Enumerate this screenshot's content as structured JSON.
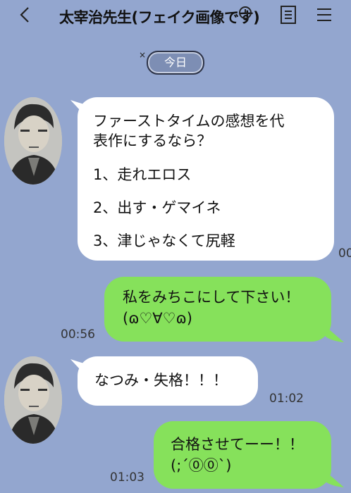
{
  "header": {
    "title": "太宰治先生(フェイク画像です)",
    "back_icon": "chevron-left-icon",
    "icons": [
      "search-icon",
      "notes-icon",
      "menu-icon"
    ]
  },
  "date_separator": {
    "mark": "×",
    "label": "今日"
  },
  "messages": [
    {
      "direction": "incoming",
      "lines": [
        "ファーストタイムの感想を代",
        "表作にするなら？",
        "1、走れエロス",
        "2、出す・ゲマイネ",
        "3、津じゃなくて尻軽"
      ],
      "time": "00"
    },
    {
      "direction": "outgoing",
      "lines": [
        "私をみちこにして下さい！",
        "(ɷ♡∀♡ɷ)"
      ],
      "time": "00:56"
    },
    {
      "direction": "incoming",
      "lines": [
        "なつみ・失格！！！"
      ],
      "time": "01:02"
    },
    {
      "direction": "outgoing",
      "lines": [
        "合格させてーー！！",
        "(;´⓪⓪`)"
      ],
      "time": "01:03"
    }
  ],
  "colors": {
    "background": "#93a6cf",
    "incoming_bubble": "#ffffff",
    "outgoing_bubble": "#86e15b"
  }
}
